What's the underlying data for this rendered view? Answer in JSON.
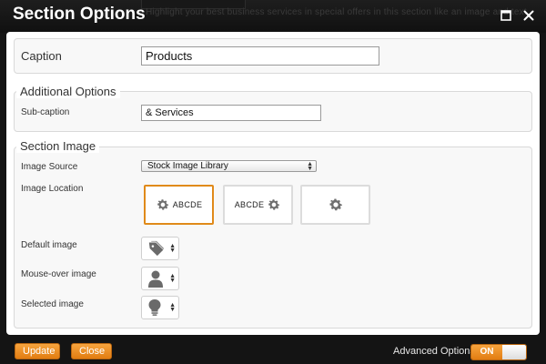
{
  "window": {
    "title": "Section Options"
  },
  "background_text": "Highlight your best business services in special offers in this section like an image and text",
  "caption": {
    "label": "Caption",
    "value": "Products"
  },
  "additional_options": {
    "legend": "Additional Options",
    "subcaption_label": "Sub-caption",
    "subcaption_value": "& Services"
  },
  "section_image": {
    "legend": "Section Image",
    "image_source_label": "Image Source",
    "image_source_value": "Stock Image Library",
    "image_location_label": "Image Location",
    "location_tiles": [
      {
        "text": "ABCDE",
        "icon": "gear-icon",
        "position": "icon-left",
        "selected": true
      },
      {
        "text": "ABCDE",
        "icon": "gear-icon",
        "position": "icon-right",
        "selected": false
      },
      {
        "text": "",
        "icon": "gear-icon",
        "position": "icon-only",
        "selected": false
      }
    ],
    "default_image_label": "Default image",
    "default_image_icon": "tag-icon",
    "mouseover_image_label": "Mouse-over image",
    "mouseover_image_icon": "person-icon",
    "selected_image_label": "Selected image",
    "selected_image_icon": "lightbulb-icon"
  },
  "footer": {
    "update_label": "Update",
    "close_label": "Close",
    "advanced_options_label": "Advanced Options",
    "toggle_label": "ON",
    "toggle_state": true
  },
  "colors": {
    "accent": "#f08c1e",
    "selected_border": "#e08a1a",
    "dark_bg": "#141414"
  }
}
